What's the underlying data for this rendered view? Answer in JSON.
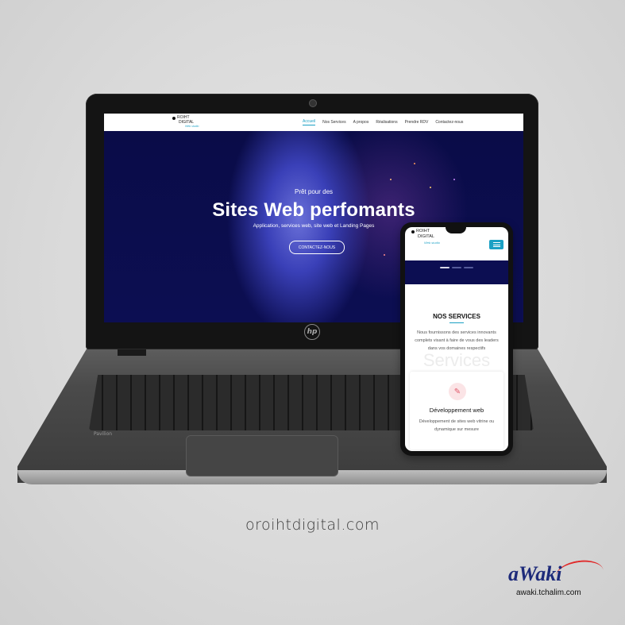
{
  "site": {
    "logo": {
      "line1": "ROIHT",
      "line2": "DIGITAL",
      "tagline": "Web studio"
    },
    "nav": {
      "items": [
        {
          "label": "Accueil",
          "active": true
        },
        {
          "label": "Nos Services",
          "active": false
        },
        {
          "label": "A propos",
          "active": false
        },
        {
          "label": "Réalisations",
          "active": false
        },
        {
          "label": "Prendre RDV",
          "active": false
        },
        {
          "label": "Contactez-nous",
          "active": false
        }
      ]
    },
    "hero": {
      "pretitle": "Prêt pour des",
      "title": "Sites Web perfomants",
      "subtitle": "Application, services web, site web et Landing Pages",
      "cta": "CONTACTEZ-NOUS"
    }
  },
  "mobile": {
    "logo": {
      "line1": "ROIHT",
      "line2": "DIGITAL",
      "tagline": "Web studio"
    },
    "menu_icon": "hamburger-icon",
    "services": {
      "title": "NOS SERVICES",
      "background_word": "Services",
      "description": "Nous fournissons des services innovants complets visant à faire de vous des leaders dans vos domaines respectifs",
      "card": {
        "icon": "pencil-icon",
        "title": "Développement web",
        "description": "Développement de sites web vitrine ou dynamique sur mesure"
      }
    }
  },
  "laptop": {
    "brand_mark": "hp",
    "model_label": "Pavilion"
  },
  "footer": {
    "domain": "oroihtdigital.com"
  },
  "watermark": {
    "logo_text": "aWaki",
    "url": "awaki.tchalim.com"
  },
  "colors": {
    "accent": "#1ba0c4",
    "hero_bg": "#0c0e52",
    "icon_bg": "#fbe4e6",
    "icon_fg": "#e0586a"
  }
}
